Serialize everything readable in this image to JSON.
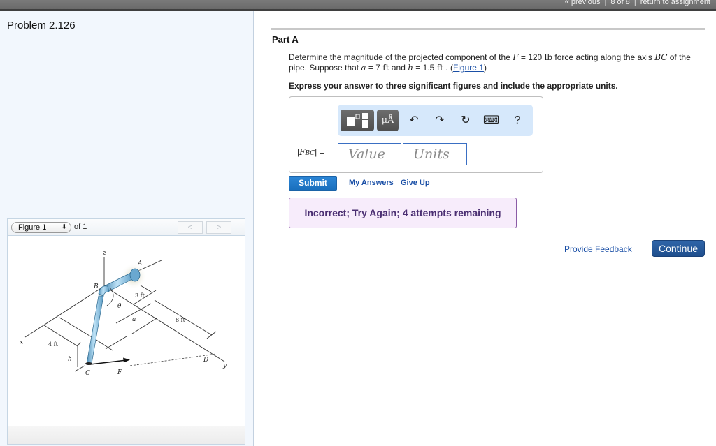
{
  "topnav": {
    "previous": "« previous",
    "position": "8 of 8",
    "return": "return to assignment"
  },
  "problem": {
    "title": "Problem 2.126"
  },
  "figure_panel": {
    "selected": "Figure 1",
    "of_label": "of 1",
    "prev": "<",
    "next": ">",
    "labels": {
      "z": "z",
      "A": "A",
      "B": "B",
      "theta": "θ",
      "three_ft": "3 ft",
      "eight_ft": "8 ft",
      "a": "a",
      "x": "x",
      "four_ft": "4 ft",
      "h": "h",
      "C": "C",
      "F": "F",
      "D": "D",
      "y": "y"
    }
  },
  "part": {
    "title": "Part A",
    "q1": "Determine the magnitude of the projected component of the ",
    "q_F": "F",
    "q2": " = 120 ",
    "q_lb": "lb",
    "q3": " force acting along the axis ",
    "q_BC": "BC",
    "q4": " of the pipe. Suppose that ",
    "q_a": "a",
    "q5": " = 7 ",
    "q_ft1": "ft",
    "q6": " and ",
    "q_h": "h",
    "q7": " = 1.5 ",
    "q_ft2": "ft",
    "q8": " . (",
    "figure_link": "Figure 1",
    "q9": ")",
    "instruction": "Express your answer to three significant figures and include the appropriate units."
  },
  "answer": {
    "label_bar_left": "|",
    "label_F": "F",
    "label_sub": "BC",
    "label_bar_right": "| =",
    "value_placeholder": "Value",
    "units_placeholder": "Units",
    "toolbar": {
      "templates": "templates-icon",
      "units_label": "μÅ",
      "undo": "↶",
      "redo": "↷",
      "reset": "↻",
      "keyboard": "⌨",
      "help": "?"
    }
  },
  "actions": {
    "submit": "Submit",
    "my_answers": "My Answers",
    "give_up": "Give Up"
  },
  "feedback": {
    "message": "Incorrect; Try Again; 4 attempts remaining"
  },
  "footer": {
    "provide_feedback": "Provide Feedback",
    "continue": "Continue"
  }
}
